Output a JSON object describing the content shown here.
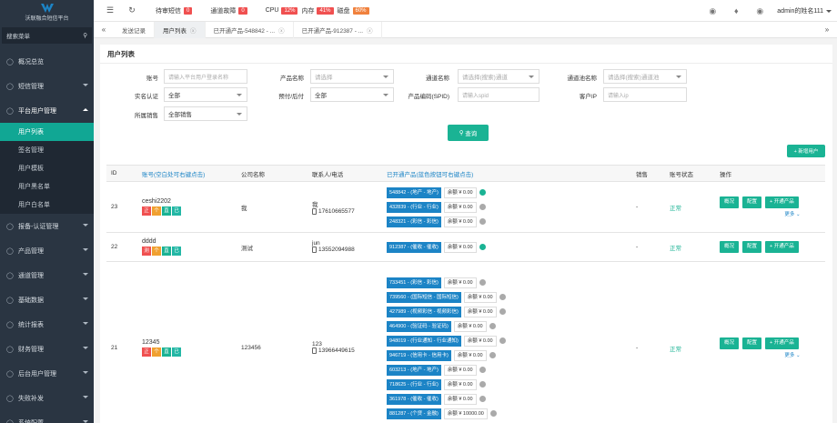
{
  "sidebar": {
    "logo_text": "沃联融合短信平台",
    "search_placeholder": "搜索菜单",
    "items": [
      {
        "label": "概况总览",
        "icon": "home-icon",
        "expandable": false
      },
      {
        "label": "短信管理",
        "icon": "mail-icon",
        "expandable": true
      },
      {
        "label": "平台用户管理",
        "icon": "user-icon",
        "expandable": true,
        "open": true,
        "children": [
          "用户列表",
          "签名管理",
          "用户模板",
          "用户黑名单",
          "用户白名单"
        ]
      },
      {
        "label": "报备-认证管理",
        "icon": "file-icon",
        "expandable": true
      },
      {
        "label": "产品管理",
        "icon": "box-icon",
        "expandable": true
      },
      {
        "label": "通道管理",
        "icon": "channel-icon",
        "expandable": true
      },
      {
        "label": "基础数据",
        "icon": "data-icon",
        "expandable": true
      },
      {
        "label": "统计报表",
        "icon": "chart-icon",
        "expandable": true
      },
      {
        "label": "财务管理",
        "icon": "finance-icon",
        "expandable": true
      },
      {
        "label": "后台用户管理",
        "icon": "admin-icon",
        "expandable": true
      },
      {
        "label": "失败补发",
        "icon": "retry-icon",
        "expandable": true
      },
      {
        "label": "系统配置",
        "icon": "gear-icon",
        "expandable": true
      }
    ],
    "active_child": "用户列表"
  },
  "topbar": {
    "pending_label": "待审短信",
    "pending_count": "0",
    "fault_label": "通道故障",
    "fault_count": "0",
    "cpu_label": "CPU",
    "cpu_value": "12%",
    "mem_label": "内存",
    "mem_value": "41%",
    "disk_label": "磁盘",
    "disk_value": "60%",
    "user_name": "admin的姓名111"
  },
  "tabs": [
    "发送记录",
    "用户列表",
    "已开通产品-548842 - ...",
    "已开通产品-912387 - ..."
  ],
  "active_tab": "用户列表",
  "page_title": "用户列表",
  "filters": {
    "account_label": "账号",
    "account_placeholder": "请输入平台用户登录名称",
    "product_label": "产品名称",
    "product_placeholder": "请选择",
    "channel_label": "通道名称",
    "channel_placeholder": "请选择(搜索)通道",
    "channel_pool_label": "通道池名称",
    "channel_pool_placeholder": "请选择(搜索)通道池",
    "realname_label": "实名认证",
    "realname_value": "全部",
    "billing_label": "预付/后付",
    "billing_value": "全部",
    "spid_label": "产品编码(SPID)",
    "spid_placeholder": "请输入spid",
    "ip_label": "客户IP",
    "ip_placeholder": "请输入ip",
    "sales_label": "所属销售",
    "sales_value": "全部销售",
    "query_button": "查询",
    "add_button": "+ 新增用户"
  },
  "table": {
    "headers": [
      "ID",
      "账号(空白处可右键点击)",
      "公司名称",
      "联系人/电话",
      "已开通产品(蓝色按钮可右键点击)",
      "销售",
      "账号状态",
      "操作"
    ],
    "op_labels": {
      "overview": "概况",
      "config": "配置",
      "open": "+ 开通产品",
      "more": "更多"
    },
    "rows": [
      {
        "id": "23",
        "account": "ceshi2202",
        "tags": [
          "正",
          "个",
          "直",
          "已"
        ],
        "company": "我",
        "contact": "我",
        "phone": "17610665577",
        "products": [
          {
            "code": "548842 - (地产 - 地产)",
            "balance": "余额 ¥ 0.00",
            "active": true
          },
          {
            "code": "432839 - (行业 - 行业)",
            "balance": "余额 ¥ 0.00",
            "active": false
          },
          {
            "code": "248321 - (彩信 - 彩信)",
            "balance": "余额 ¥ 0.00",
            "active": false
          }
        ],
        "sales": "-",
        "status": "正常"
      },
      {
        "id": "22",
        "account": "dddd",
        "tags": [
          "测",
          "个",
          "直",
          "已"
        ],
        "company": "测试",
        "contact": "jun",
        "phone": "13552094988",
        "products": [
          {
            "code": "912387 - (催收 - 催收)",
            "balance": "余额 ¥ 0.00",
            "active": true
          }
        ],
        "sales": "-",
        "status": "正常"
      },
      {
        "id": "21",
        "account": "12345",
        "tags": [
          "正",
          "个",
          "直",
          "已"
        ],
        "company": "123456",
        "contact": "123",
        "phone": "13966449615",
        "products": [
          {
            "code": "733451 - (彩信 - 彩信)",
            "balance": "余额 ¥ 0.00",
            "active": false
          },
          {
            "code": "739560 - (国际短信 - 国际短信)",
            "balance": "余额 ¥ 0.00",
            "active": false
          },
          {
            "code": "427989 - (视频彩信 - 视频彩信)",
            "balance": "余额 ¥ 0.00",
            "active": false
          },
          {
            "code": "464900 - (验证码 - 验证码)",
            "balance": "余额 ¥ 0.00",
            "active": false
          },
          {
            "code": "948019 - (行业通知 - 行业通知)",
            "balance": "余额 ¥ 0.00",
            "active": false
          },
          {
            "code": "946719 - (信用卡 - 信用卡)",
            "balance": "余额 ¥ 0.00",
            "active": false
          },
          {
            "code": "603213 - (地产 - 地产)",
            "balance": "余额 ¥ 0.00",
            "active": false
          },
          {
            "code": "718625 - (行业 - 行业)",
            "balance": "余额 ¥ 0.00",
            "active": false
          },
          {
            "code": "361978 - (催收 - 催收)",
            "balance": "余额 ¥ 0.00",
            "active": false
          },
          {
            "code": "881287 - (个贷 - 金融)",
            "balance": "余额 ¥ 10000.00",
            "active": false
          }
        ],
        "sales": "-",
        "status": "正常"
      }
    ]
  },
  "colors": {
    "accent": "#1ab394",
    "sidebar": "#2a3542",
    "chip": "#1c84c6",
    "badge": "#f05050"
  }
}
